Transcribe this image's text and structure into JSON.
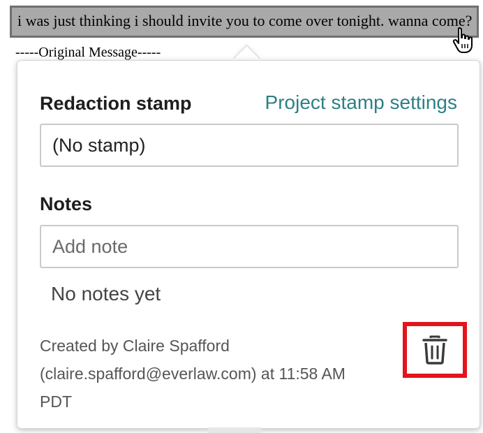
{
  "document": {
    "highlighted_text": "i was just thinking i should invite you to come over tonight. wanna come?",
    "next_line": "-----Original Message-----"
  },
  "popover": {
    "redaction_stamp_label": "Redaction stamp",
    "project_stamp_settings_link": "Project stamp settings",
    "stamp_select_value": "(No stamp)",
    "notes_label": "Notes",
    "note_input_placeholder": "Add note",
    "empty_notes_text": "No notes yet",
    "created_by_lines": [
      "Created by Claire Spafford",
      "(claire.spafford@everlaw.com) at 11:58 AM",
      "PDT"
    ],
    "delete_icon": "trash-icon"
  },
  "colors": {
    "highlight_fill": "#a9a9a9",
    "highlight_border": "#707070",
    "link_color": "#2f7f86",
    "callout_red": "#e3141c"
  }
}
